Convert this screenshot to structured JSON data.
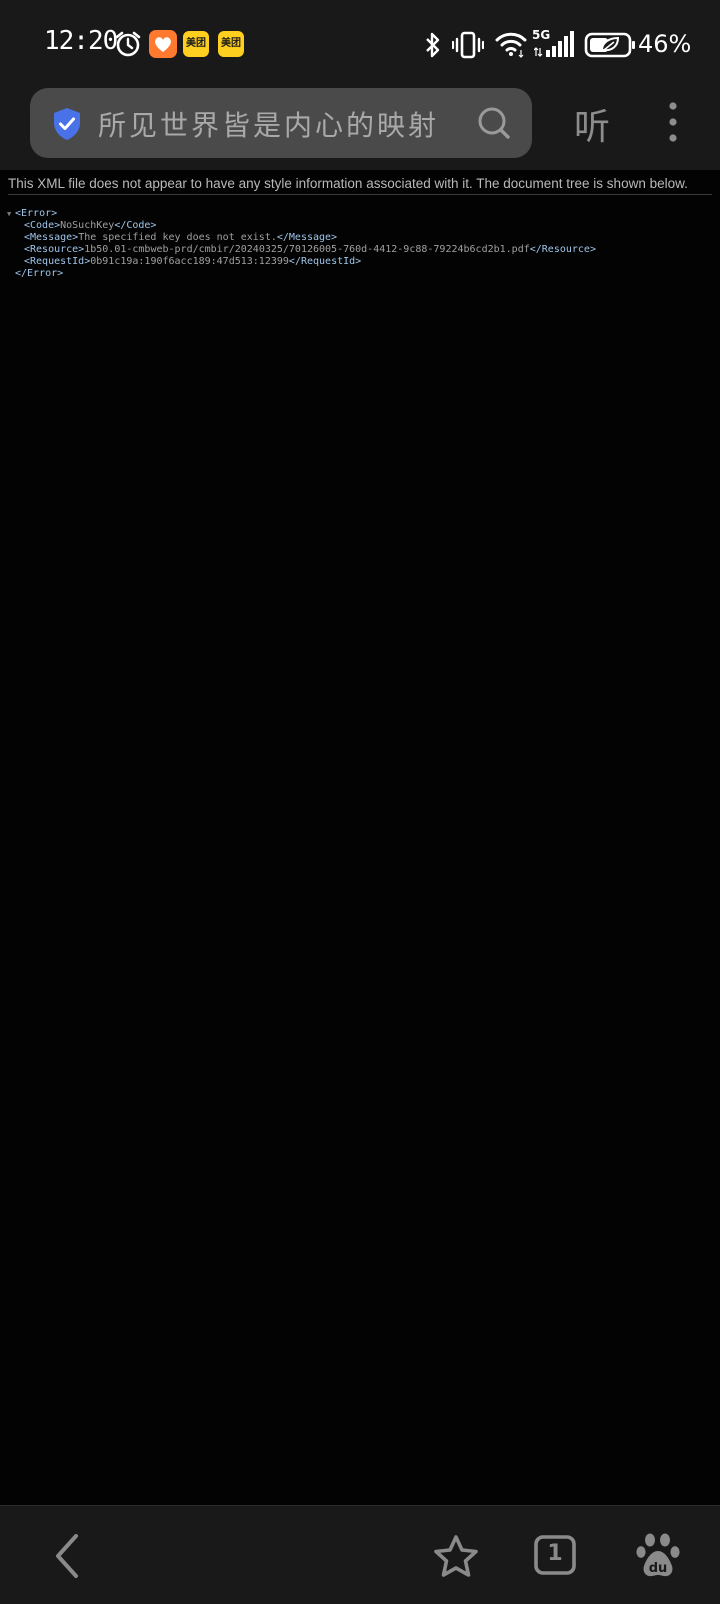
{
  "status_bar": {
    "time": "12:20",
    "app_badge_1": "美团",
    "app_badge_2": "美团",
    "network": "5G",
    "battery": "46%"
  },
  "toolbar": {
    "search_text": "所见世界皆是内心的映射",
    "listen_label": "听"
  },
  "page": {
    "notice": "This XML file does not appear to have any style information associated with it. The document tree is shown below.",
    "xml": {
      "root_open": "<Error>",
      "code_open": "<Code>",
      "code_value": "NoSuchKey",
      "code_close": "</Code>",
      "message_open": "<Message>",
      "message_value": "The specified key does not exist.",
      "message_close": "</Message>",
      "resource_open": "<Resource>",
      "resource_value": "1b50.01-cmbweb-prd/cmbir/20240325/70126005-760d-4412-9c88-79224b6cd2b1.pdf",
      "resource_close": "</Resource>",
      "requestid_open": "<RequestId>",
      "requestid_value": "0b91c19a:190f6acc189:47d513:12399",
      "requestid_close": "</RequestId>",
      "root_close": "</Error>"
    }
  },
  "bottom_nav": {
    "tab_count": "1"
  },
  "icons": {
    "alarm": "alarm-icon",
    "heart_app": "heart-app-icon",
    "bluetooth": "bluetooth-icon",
    "vibrate": "vibrate-icon",
    "wifi": "wifi-icon",
    "signal": "signal-icon",
    "battery": "battery-icon",
    "shield": "shield-icon",
    "search": "search-icon",
    "more": "more-vertical-icon",
    "back": "back-arrow-icon",
    "star": "star-icon",
    "tabs": "tabs-icon",
    "baidu": "baidu-paw-icon"
  },
  "colors": {
    "background": "#030303",
    "bar": "#191919",
    "search_box": "#4a4a4a",
    "shield": "#4a72e8",
    "tag": "#9fc5ea",
    "badge": "#ffcf1f"
  }
}
